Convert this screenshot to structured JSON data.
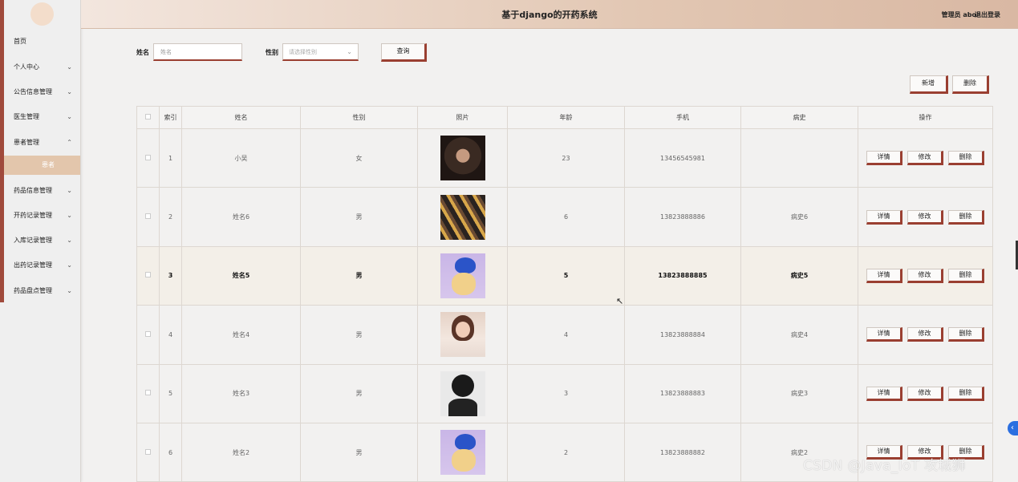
{
  "header": {
    "title": "基于django的开药系统",
    "user": "管理员 abo",
    "logout": "退出登录"
  },
  "sidebar": {
    "items": [
      {
        "label": "首页",
        "chevron": ""
      },
      {
        "label": "个人中心",
        "chevron": "⌄"
      },
      {
        "label": "公告信息管理",
        "chevron": "⌄"
      },
      {
        "label": "医生管理",
        "chevron": "⌄"
      },
      {
        "label": "患者管理",
        "chevron": "⌃"
      },
      {
        "label": "药品信息管理",
        "chevron": "⌄"
      },
      {
        "label": "开药记录管理",
        "chevron": "⌄"
      },
      {
        "label": "入库记录管理",
        "chevron": "⌄"
      },
      {
        "label": "出药记录管理",
        "chevron": "⌄"
      },
      {
        "label": "药品盘点管理",
        "chevron": "⌄"
      }
    ],
    "active_sub": "患者"
  },
  "search": {
    "name_label": "姓名",
    "name_placeholder": "姓名",
    "gender_label": "性别",
    "gender_placeholder": "请选择性别",
    "query_button": "查询"
  },
  "actions": {
    "add": "新增",
    "delete": "删除"
  },
  "table": {
    "columns": [
      "索引",
      "姓名",
      "性别",
      "照片",
      "年龄",
      "手机",
      "病史",
      "操作"
    ],
    "row_buttons": {
      "detail": "详情",
      "edit": "修改",
      "delete": "删除"
    },
    "rows": [
      {
        "index": "1",
        "name": "小吴",
        "gender": "女",
        "photo": "ph-dark",
        "age": "23",
        "phone": "13456545981",
        "history": ""
      },
      {
        "index": "2",
        "name": "姓名6",
        "gender": "男",
        "photo": "ph-stripes",
        "age": "6",
        "phone": "13823888886",
        "history": "病史6"
      },
      {
        "index": "3",
        "name": "姓名5",
        "gender": "男",
        "photo": "ph-cartoon",
        "age": "5",
        "phone": "13823888885",
        "history": "病史5"
      },
      {
        "index": "4",
        "name": "姓名4",
        "gender": "男",
        "photo": "ph-girl",
        "age": "4",
        "phone": "13823888884",
        "history": "病史4"
      },
      {
        "index": "5",
        "name": "姓名3",
        "gender": "男",
        "photo": "ph-bw",
        "age": "3",
        "phone": "13823888883",
        "history": "病史3"
      },
      {
        "index": "6",
        "name": "姓名2",
        "gender": "男",
        "photo": "ph-cartoon",
        "age": "2",
        "phone": "13823888882",
        "history": "病史2"
      }
    ]
  },
  "watermark": "CSDN @Java_IoT 攻城狮",
  "colors": {
    "accent": "#9a3f31",
    "header_start": "#f3e6de",
    "header_end": "#d9b8a3",
    "active_sub_bg": "#e3c6ac"
  }
}
